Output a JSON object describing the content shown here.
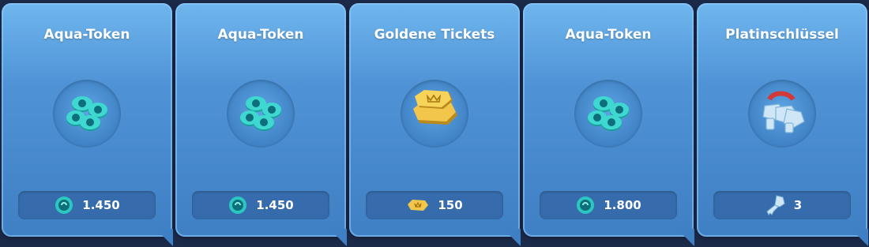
{
  "cards": [
    {
      "title": "Aqua-Token",
      "amount": "1.450",
      "icon": "aqua-token-icon"
    },
    {
      "title": "Aqua-Token",
      "amount": "1.450",
      "icon": "aqua-token-icon"
    },
    {
      "title": "Goldene Tickets",
      "amount": "150",
      "icon": "golden-ticket-icon"
    },
    {
      "title": "Aqua-Token",
      "amount": "1.800",
      "icon": "aqua-token-icon"
    },
    {
      "title": "Platinschlüssel",
      "amount": "3",
      "icon": "platinum-key-icon"
    }
  ],
  "colors": {
    "card": "#4f93d6",
    "aqua": "#2bc7c1",
    "gold": "#e7b53a",
    "platinum": "#cfe6f7",
    "key_ribbon": "#d23a3a"
  }
}
